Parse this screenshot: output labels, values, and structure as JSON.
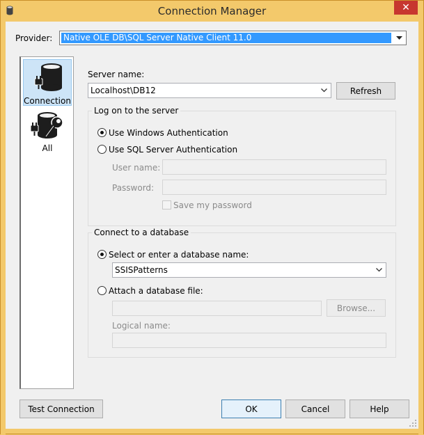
{
  "window": {
    "title": "Connection Manager",
    "close_glyph": "✕"
  },
  "provider": {
    "label": "Provider:",
    "value": "Native OLE DB\\SQL Server Native Client 11.0"
  },
  "sidebar": {
    "items": [
      {
        "label": "Connection",
        "icon": "database-connection-icon",
        "selected": true
      },
      {
        "label": "All",
        "icon": "database-wrench-icon",
        "selected": false
      }
    ]
  },
  "server": {
    "label": "Server name:",
    "value": "Localhost\\DB12",
    "refresh_label": "Refresh"
  },
  "logon": {
    "group_title": "Log on to the server",
    "windows_auth_label": "Use Windows Authentication",
    "sql_auth_label": "Use SQL Server Authentication",
    "selected": "windows",
    "user_name_label": "User name:",
    "password_label": "Password:",
    "save_password_label": "Save my password"
  },
  "database": {
    "group_title": "Connect to a database",
    "select_label": "Select or enter a database name:",
    "selected_db": "SSISPatterns",
    "attach_label": "Attach a database file:",
    "browse_label": "Browse...",
    "logical_name_label": "Logical name:"
  },
  "footer": {
    "test_connection_label": "Test Connection",
    "ok_label": "OK",
    "cancel_label": "Cancel",
    "help_label": "Help"
  },
  "colors": {
    "title_bar": "#f3c96b",
    "selection": "#3399ff",
    "close": "#c7372f"
  }
}
